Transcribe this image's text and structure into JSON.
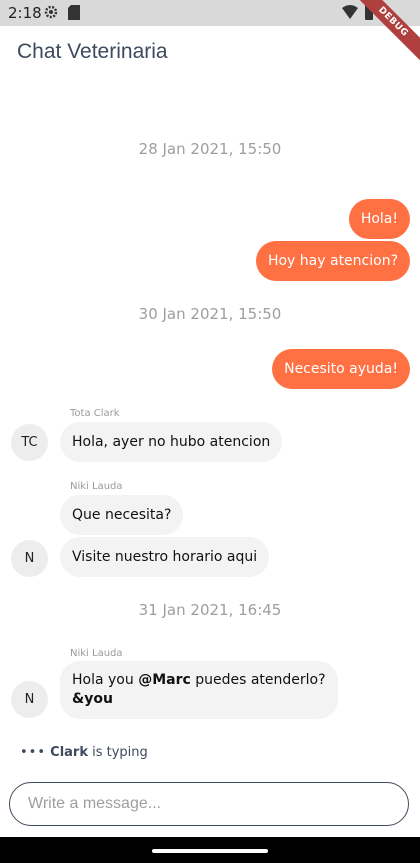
{
  "status": {
    "time": "2:18",
    "debug": "DEBUG"
  },
  "app": {
    "title": "Chat Veterinaria"
  },
  "dates": [
    "28 Jan 2021, 15:50",
    "30 Jan 2021, 15:50",
    "31 Jan 2021, 16:45"
  ],
  "outgoing": [
    "Hola!",
    "Hoy hay atencion?",
    "Necesito ayuda!"
  ],
  "incoming": {
    "tota": {
      "name": "Tota Clark",
      "initials": "TC",
      "text": "Hola, ayer no hubo atencion"
    },
    "niki1": {
      "name": "Niki Lauda",
      "initials": "N",
      "msg1": "Que necesita?",
      "msg2": "Visite nuestro horario aqui"
    },
    "niki2": {
      "name": "Niki Lauda",
      "initials": "N",
      "part1": "Hola you ",
      "mention1": "@Marc",
      "part2": " puedes atenderlo?",
      "mention2": "&you"
    }
  },
  "typing": {
    "dots": "•••",
    "name": "Clark",
    "text": " is typing"
  },
  "composer": {
    "placeholder": "Write a message..."
  },
  "colors": {
    "accent": "#ff7043",
    "incoming_bg": "#f3f3f3",
    "title": "#3e4a5d"
  }
}
